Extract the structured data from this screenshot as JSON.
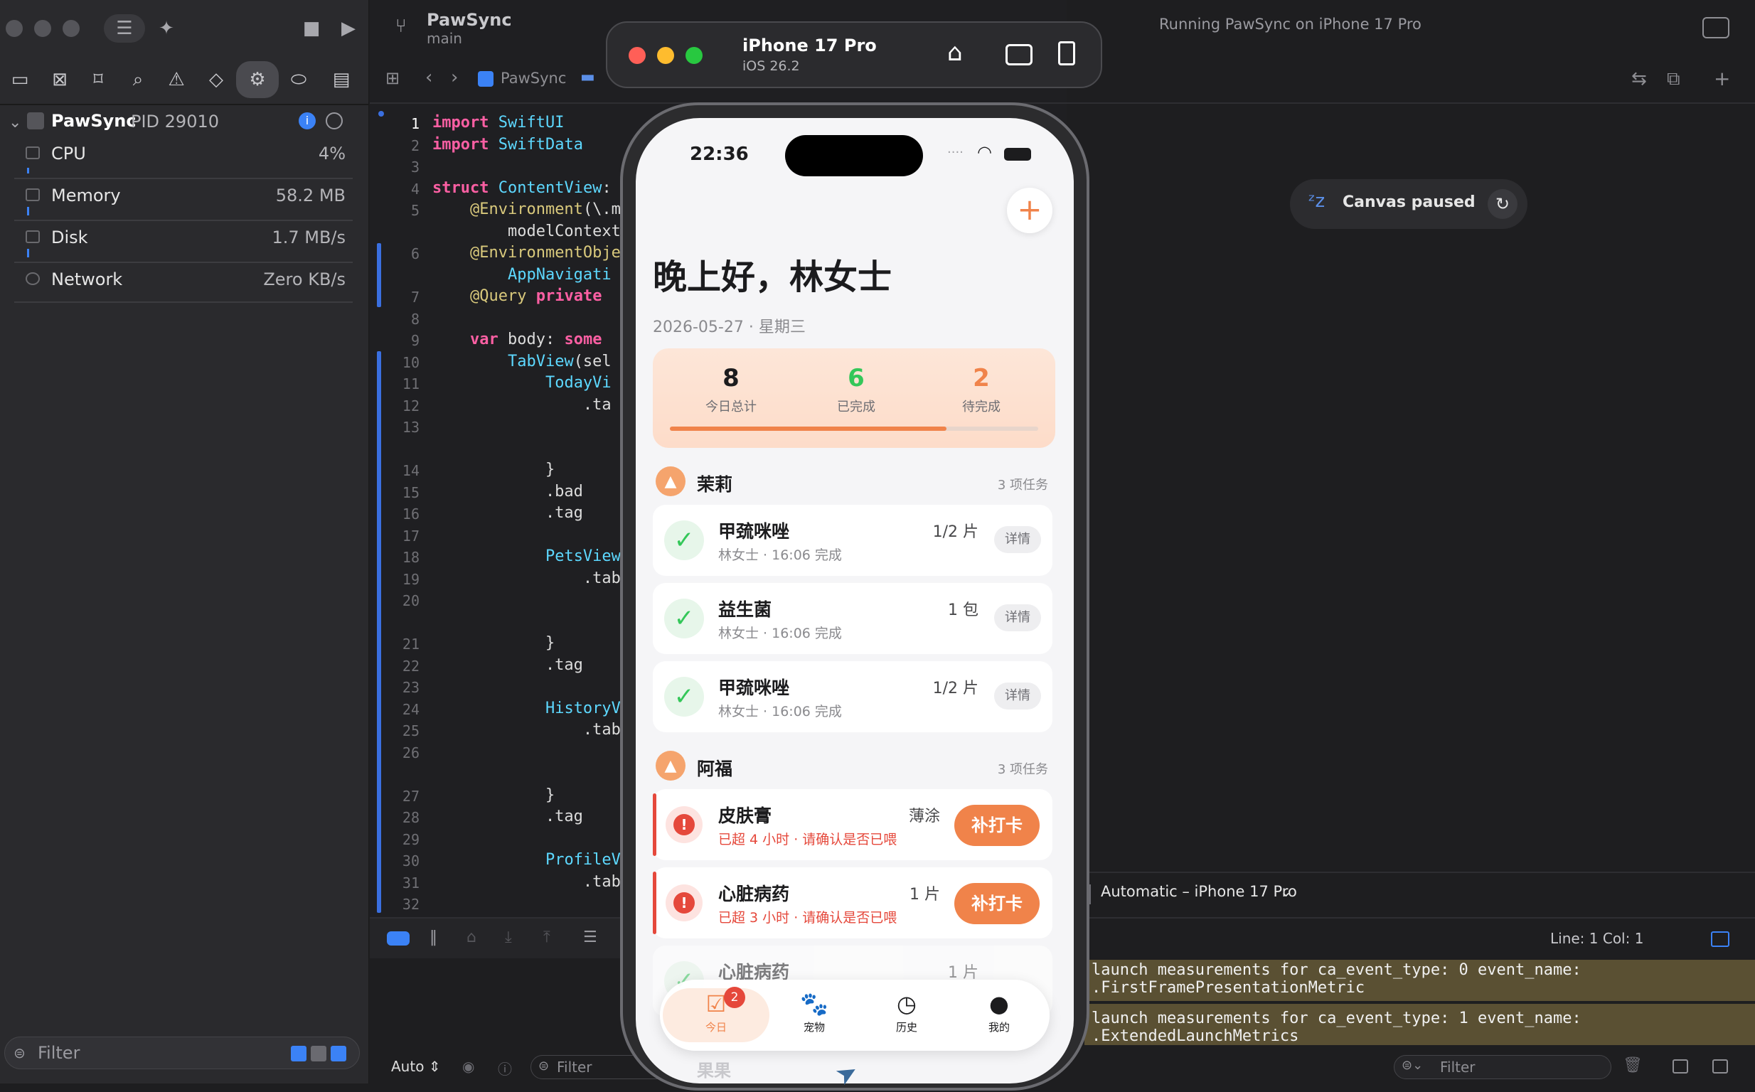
{
  "xcode": {
    "scheme": "PawSync",
    "branch": "main",
    "status": "Running PawSync on iPhone 17 Pro",
    "breadcrumb": "PawSync",
    "process": {
      "name": "PawSync",
      "pid": "PID 29010"
    },
    "gauges": [
      {
        "name": "CPU",
        "value": "4%"
      },
      {
        "name": "Memory",
        "value": "58.2 MB"
      },
      {
        "name": "Disk",
        "value": "1.7 MB/s"
      },
      {
        "name": "Network",
        "value": "Zero KB/s"
      }
    ],
    "filter_placeholder": "Filter",
    "canvas_status": "Canvas paused",
    "preview_device": "Automatic – iPhone 17 Pro",
    "cursor_pos": "Line: 1  Col: 1",
    "auto_label": "Auto ⇕",
    "log_lines": [
      "launch measurements for ca_event_type: 0 event_name:",
      ".FirstFramePresentationMetric",
      "launch measurements for ca_event_type: 1 event_name:",
      ".ExtendedLaunchMetrics"
    ]
  },
  "code_lines": [
    {
      "n": "1",
      "t": "import SwiftUI"
    },
    {
      "n": "2",
      "t": "import SwiftData"
    },
    {
      "n": "3",
      "t": ""
    },
    {
      "n": "4",
      "t": "struct ContentView:"
    },
    {
      "n": "5",
      "t": "    @Environment(\\.m"
    },
    {
      "n": "",
      "t": "        modelContext"
    },
    {
      "n": "6",
      "t": "    @EnvironmentObje"
    },
    {
      "n": "",
      "t": "        AppNavigati"
    },
    {
      "n": "7",
      "t": "    @Query private"
    },
    {
      "n": "8",
      "t": ""
    },
    {
      "n": "9",
      "t": "    var body: some "
    },
    {
      "n": "10",
      "t": "        TabView(sel"
    },
    {
      "n": "11",
      "t": "            TodayVi"
    },
    {
      "n": "12",
      "t": "                .ta"
    },
    {
      "n": "13",
      "t": ""
    },
    {
      "n": "",
      "t": ""
    },
    {
      "n": "14",
      "t": "            }"
    },
    {
      "n": "15",
      "t": "            .bad"
    },
    {
      "n": "16",
      "t": "            .tag"
    },
    {
      "n": "17",
      "t": ""
    },
    {
      "n": "18",
      "t": "            PetsView"
    },
    {
      "n": "19",
      "t": "                .tab"
    },
    {
      "n": "20",
      "t": ""
    },
    {
      "n": "",
      "t": ""
    },
    {
      "n": "21",
      "t": "            }"
    },
    {
      "n": "22",
      "t": "            .tag"
    },
    {
      "n": "23",
      "t": ""
    },
    {
      "n": "24",
      "t": "            HistoryV"
    },
    {
      "n": "25",
      "t": "                .tab"
    },
    {
      "n": "26",
      "t": ""
    },
    {
      "n": "",
      "t": ""
    },
    {
      "n": "27",
      "t": "            }"
    },
    {
      "n": "28",
      "t": "            .tag"
    },
    {
      "n": "29",
      "t": ""
    },
    {
      "n": "30",
      "t": "            ProfileV"
    },
    {
      "n": "31",
      "t": "                .tab"
    },
    {
      "n": "32",
      "t": ""
    }
  ],
  "simulator": {
    "device": "iPhone 17 Pro",
    "os": "iOS 26.2"
  },
  "app": {
    "time": "22:36",
    "greeting": "晚上好，林女士",
    "date": "2026-05-27 · 星期三",
    "summary": {
      "total": "8",
      "total_label": "今日总计",
      "done": "6",
      "done_label": "已完成",
      "pending": "2",
      "pending_label": "待完成",
      "progress": 0.75
    },
    "pets": [
      {
        "name": "茉莉",
        "count": "3 项任务",
        "tasks": [
          {
            "name": "甲巯咪唑",
            "sub": "林女士 · 16:06 完成",
            "dose": "1/2 片",
            "action": "详情"
          },
          {
            "name": "益生菌",
            "sub": "林女士 · 16:06 完成",
            "dose": "1 包",
            "action": "详情"
          },
          {
            "name": "甲巯咪唑",
            "sub": "林女士 · 16:06 完成",
            "dose": "1/2 片",
            "action": "详情"
          }
        ]
      },
      {
        "name": "阿福",
        "count": "3 项任务",
        "tasks": [
          {
            "name": "皮肤膏",
            "sub": "已超 4 小时 · 请确认是否已喂",
            "dose": "薄涂",
            "action": "补打卡"
          },
          {
            "name": "心脏病药",
            "sub": "已超 3 小时 · 请确认是否已喂",
            "dose": "1 片",
            "action": "补打卡"
          },
          {
            "name": "心脏病药",
            "sub": "",
            "dose": "1 片",
            "action": ""
          }
        ]
      }
    ],
    "third_pet": "果果",
    "tabs": [
      {
        "label": "今日",
        "badge": "2"
      },
      {
        "label": "宠物"
      },
      {
        "label": "历史"
      },
      {
        "label": "我的"
      }
    ],
    "colors": {
      "accent": "#f0834a",
      "done": "#34c759",
      "alert": "#e5483b"
    }
  }
}
